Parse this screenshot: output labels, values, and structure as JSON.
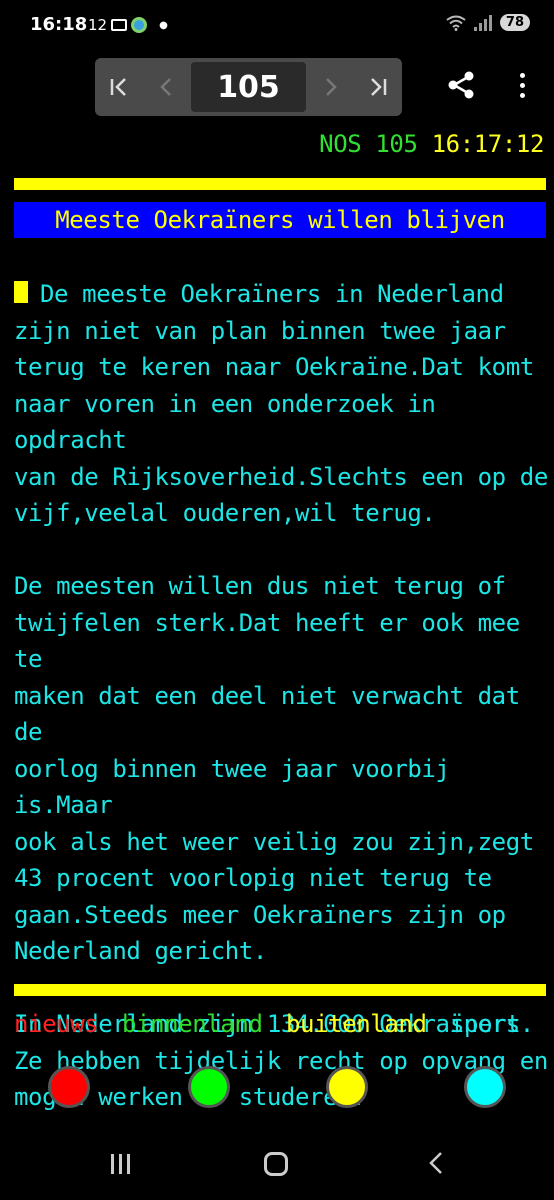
{
  "status_bar": {
    "time": "16:18",
    "notification_count": "12",
    "battery": "78"
  },
  "navigator": {
    "first_icon": "first-page-icon",
    "prev_icon": "previous-page-icon",
    "page": "105",
    "next_icon": "next-page-icon",
    "last_icon": "last-page-icon",
    "share_icon": "share-icon",
    "menu_icon": "more-vert-icon"
  },
  "teletext": {
    "header_source": "NOS 105",
    "header_time": "16:17:12",
    "headline": "Meeste Oekraïners willen blijven",
    "body_lines": [
      "De meeste Oekraïners in Nederland",
      "zijn niet van plan binnen twee jaar",
      "terug te keren naar Oekraïne.Dat komt",
      "naar voren in een onderzoek in opdracht",
      "van de Rijksoverheid.Slechts een op de",
      "vijf,veelal ouderen,wil terug.",
      "",
      "De meesten willen dus niet terug of",
      "twijfelen sterk.Dat heeft er ook mee te",
      "maken dat een deel niet verwacht dat de",
      "oorlog binnen twee jaar voorbij is.Maar",
      "ook als het weer veilig zou zijn,zegt",
      "43 procent voorlopig niet terug te",
      "gaan.Steeds meer Oekraïners zijn op",
      "Nederland gericht.",
      "",
      "In Nederland zijn 134.000 Oekraïners.",
      "Ze hebben tijdelijk recht op opvang en",
      "mogen werken of studeren."
    ],
    "fastext": {
      "red": "nieuws",
      "green": "binnenland",
      "yellow": "buitenland",
      "cyan": "sport"
    }
  },
  "colors": {
    "red": "#ff0000",
    "green": "#00ff00",
    "yellow": "#ffff00",
    "cyan": "#00ffff",
    "headline_bg": "#0000ff"
  },
  "system_nav": {
    "recent_icon": "recent-apps-icon",
    "home_icon": "home-icon",
    "back_icon": "back-icon"
  }
}
